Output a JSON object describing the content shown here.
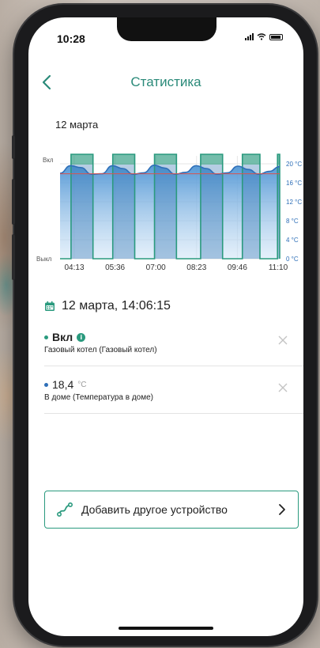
{
  "status": {
    "time": "10:28"
  },
  "nav": {
    "title": "Статистика"
  },
  "chart_data": {
    "type": "line",
    "title": "12 марта",
    "x_ticks": [
      "04:13",
      "05:36",
      "07:00",
      "08:23",
      "09:46",
      "11:10"
    ],
    "left_axis": {
      "top_label": "Вкл",
      "bottom_label": "Выкл"
    },
    "right_axis": {
      "ticks": [
        "20 °C",
        "16 °C",
        "12 °C",
        "8 °C",
        "4 °C",
        "0 °C"
      ],
      "ylim": [
        0,
        20
      ]
    },
    "series": [
      {
        "kind": "onoff",
        "color": "#2a9a7e",
        "on_periods": [
          [
            0.05,
            0.15
          ],
          [
            0.24,
            0.34
          ],
          [
            0.43,
            0.53
          ],
          [
            0.64,
            0.74
          ],
          [
            0.83,
            0.91
          ],
          [
            0.99,
            1.0
          ]
        ]
      },
      {
        "kind": "temperature",
        "color": "#2e6fb8",
        "values": [
          18.0,
          19.6,
          19.2,
          17.8,
          17.9,
          19.6,
          19.0,
          17.8,
          18.1,
          19.7,
          19.1,
          17.8,
          18.2,
          19.6,
          19.0,
          17.8,
          18.1,
          19.5,
          18.8,
          17.8,
          18.4,
          19.4
        ]
      }
    ],
    "setpoint": {
      "value": 17.9,
      "color": "#d9534f"
    }
  },
  "selection": {
    "datetime": "12 марта, 14:06:15"
  },
  "items": [
    {
      "value": "Вкл",
      "unit": "",
      "subtitle": "Газовый котел (Газовый котел)",
      "dot_color": "#2a9a7e"
    },
    {
      "value": "18,4",
      "unit": "°C",
      "subtitle": "В доме (Температура в доме)",
      "dot_color": "#2e6fb8"
    }
  ],
  "add_device": {
    "label": "Добавить другое устройство"
  },
  "colors": {
    "accent": "#2a9a7e",
    "temp": "#2e6fb8"
  },
  "icons": [
    "back-chevron-icon",
    "calendar-icon",
    "info-icon",
    "close-icon",
    "add-device-icon",
    "chevron-right-icon"
  ]
}
